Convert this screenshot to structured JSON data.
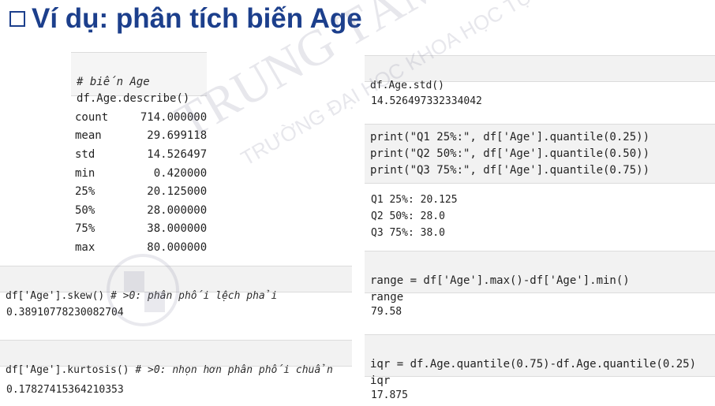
{
  "title": "Ví dụ: phân tích biến Age",
  "left": {
    "describe_comment": "# biến Age",
    "describe_code": "df.Age.describe()",
    "describe_rows": [
      {
        "k": "count",
        "v": "714.000000"
      },
      {
        "k": "mean",
        "v": "29.699118"
      },
      {
        "k": "std",
        "v": "14.526497"
      },
      {
        "k": "min",
        "v": "0.420000"
      },
      {
        "k": "25%",
        "v": "20.125000"
      },
      {
        "k": "50%",
        "v": "28.000000"
      },
      {
        "k": "75%",
        "v": "38.000000"
      },
      {
        "k": "max",
        "v": "80.000000"
      }
    ],
    "skew_code": "df['Age'].skew()",
    "skew_comment": "# >0: phân phối lệch phải",
    "skew_output": "0.38910778230082704",
    "kurt_code": "df['Age'].kurtosis()",
    "kurt_comment": "# >0: nhọn hơn phân phối chuẩn",
    "kurt_output": "0.17827415364210353"
  },
  "right": {
    "std_code": "df.Age.std()",
    "std_output": "14.526497332334042",
    "print_lines": [
      "print(\"Q1 25%:\", df['Age'].quantile(0.25))",
      "print(\"Q2 50%:\", df['Age'].quantile(0.50))",
      "print(\"Q3 75%:\", df['Age'].quantile(0.75))"
    ],
    "quantile_output": [
      "Q1 25%: 20.125",
      "Q2 50%: 28.0",
      "Q3 75%: 38.0"
    ],
    "range_code": "range = df['Age'].max()-df['Age'].min()",
    "range_var": "range",
    "range_output": "79.58",
    "iqr_code": "iqr = df.Age.quantile(0.75)-df.Age.quantile(0.25)",
    "iqr_var": "iqr",
    "iqr_output": "17.875"
  },
  "watermark": {
    "main": "TRUNG TÂM TIN HỌC",
    "sub": "TRƯỜNG ĐẠI HỌC KHOA HỌC TỰ NHIÊN"
  }
}
